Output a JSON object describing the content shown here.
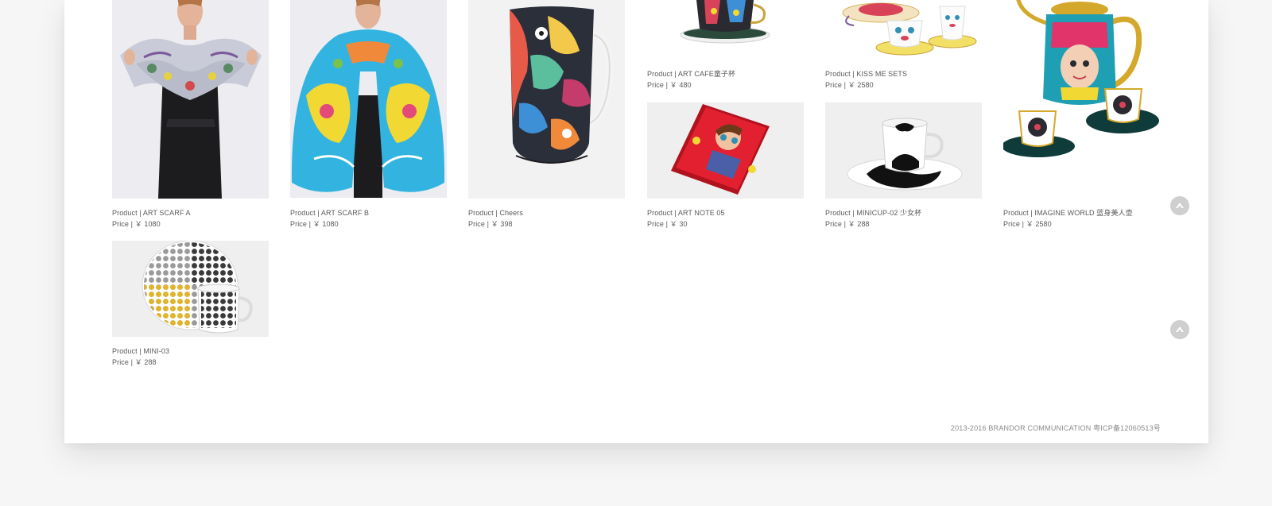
{
  "products": [
    {
      "name": "Product | ART SCARF A",
      "price": "Price | ￥ 1080",
      "image": "woman-scarf-image"
    },
    {
      "name": "Product | ART SCARF B",
      "price": "Price | ￥ 1080",
      "image": "woman-cape-scarf-image"
    },
    {
      "name": "Product | Cheers",
      "price": "Price | ￥ 398",
      "image": "painted-mug-image"
    },
    {
      "name": "Product | ART CAFE童子杯",
      "price": "Price | ￥ 480",
      "image": "cup-saucer-image"
    },
    {
      "name": "Product | KISS ME SETS",
      "price": "Price | ￥ 2580",
      "image": "tea-set-image"
    },
    {
      "name": "Product | ART NOTE 05",
      "price": "Price | ￥ 30",
      "image": "red-notebook-image"
    },
    {
      "name": "Product | MINICUP-02 少女杯",
      "price": "Price | ￥ 288",
      "image": "white-cup-image"
    },
    {
      "name": "Product | IMAGINE WORLD 蓝身美人壶",
      "price": "Price | ￥ 2580",
      "image": "teapot-set-image"
    },
    {
      "name": "Product | MINI-03",
      "price": "Price | ￥ 288",
      "image": "dotted-cup-image"
    }
  ],
  "controls": {
    "back_to_top_icon": "chevron-up-icon"
  },
  "footer": {
    "copyright": "2013-2016 BRANDOR COMMUNICATION    粤ICP备12060513号"
  },
  "colors": {
    "page_background": "#f6f6f7",
    "card_background": "#ffffff",
    "text": "#5a5a5a",
    "scroll_button": "#cfcfcf"
  }
}
